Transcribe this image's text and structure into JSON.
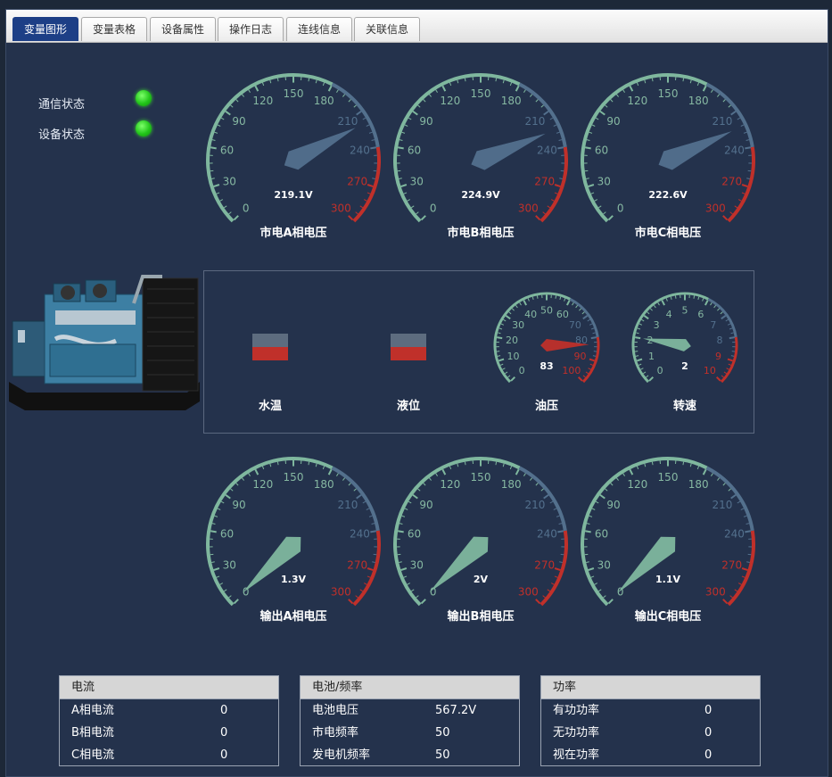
{
  "tabs": [
    {
      "label": "变量图形",
      "active": true
    },
    {
      "label": "变量表格",
      "active": false
    },
    {
      "label": "设备属性",
      "active": false
    },
    {
      "label": "操作日志",
      "active": false
    },
    {
      "label": "连线信息",
      "active": false
    },
    {
      "label": "关联信息",
      "active": false
    }
  ],
  "status": {
    "comm_label": "通信状态",
    "device_label": "设备状态",
    "led_color": "#22c61a"
  },
  "colors": {
    "background": "#24324c",
    "scale_green": "#7fb79e",
    "scale_blue": "#53708d",
    "scale_red": "#c0302a",
    "active_tab": "#1d3f86"
  },
  "mains_gauges": [
    {
      "title": "市电A相电压",
      "value": 219.1,
      "display": "219.1V",
      "min": 0,
      "max": 300,
      "ticks": [
        "0",
        "30",
        "60",
        "90",
        "120",
        "150",
        "180",
        "210",
        "240",
        "270",
        "300"
      ]
    },
    {
      "title": "市电B相电压",
      "value": 224.9,
      "display": "224.9V",
      "min": 0,
      "max": 300,
      "ticks": [
        "0",
        "30",
        "60",
        "90",
        "120",
        "150",
        "180",
        "210",
        "240",
        "270",
        "300"
      ]
    },
    {
      "title": "市电C相电压",
      "value": 222.6,
      "display": "222.6V",
      "min": 0,
      "max": 300,
      "ticks": [
        "0",
        "30",
        "60",
        "90",
        "120",
        "150",
        "180",
        "210",
        "240",
        "270",
        "300"
      ]
    }
  ],
  "output_gauges": [
    {
      "title": "输出A相电压",
      "value": 1.3,
      "display": "1.3V",
      "min": 0,
      "max": 300,
      "ticks": [
        "0",
        "30",
        "60",
        "90",
        "120",
        "150",
        "180",
        "210",
        "240",
        "270",
        "300"
      ]
    },
    {
      "title": "输出B相电压",
      "value": 2,
      "display": "2V",
      "min": 0,
      "max": 300,
      "ticks": [
        "0",
        "30",
        "60",
        "90",
        "120",
        "150",
        "180",
        "210",
        "240",
        "270",
        "300"
      ]
    },
    {
      "title": "输出C相电压",
      "value": 1.1,
      "display": "1.1V",
      "min": 0,
      "max": 300,
      "ticks": [
        "0",
        "30",
        "60",
        "90",
        "120",
        "150",
        "180",
        "210",
        "240",
        "270",
        "300"
      ]
    }
  ],
  "engine": {
    "water_temp": {
      "label": "水温",
      "level": 0.5
    },
    "level": {
      "label": "液位",
      "level": 0.5
    },
    "oil_pressure": {
      "title": "油压",
      "value": 83,
      "display": "83",
      "min": 0,
      "max": 100,
      "ticks": [
        "0",
        "10",
        "20",
        "30",
        "40",
        "50",
        "60",
        "70",
        "80",
        "90",
        "100"
      ]
    },
    "speed": {
      "title": "转速",
      "value": 2,
      "display": "2",
      "min": 0,
      "max": 10,
      "ticks": [
        "0",
        "1",
        "2",
        "3",
        "4",
        "5",
        "6",
        "7",
        "8",
        "9",
        "10"
      ]
    }
  },
  "tables": [
    {
      "title": "电流",
      "rows": [
        {
          "label": "A相电流",
          "value": "0"
        },
        {
          "label": "B相电流",
          "value": "0"
        },
        {
          "label": "C相电流",
          "value": "0"
        }
      ]
    },
    {
      "title": "电池/频率",
      "rows": [
        {
          "label": "电池电压",
          "value": "567.2V"
        },
        {
          "label": "市电频率",
          "value": "50"
        },
        {
          "label": "发电机频率",
          "value": "50"
        }
      ]
    },
    {
      "title": "功率",
      "rows": [
        {
          "label": "有功功率",
          "value": "0"
        },
        {
          "label": "无功功率",
          "value": "0"
        },
        {
          "label": "视在功率",
          "value": "0"
        }
      ]
    }
  ]
}
